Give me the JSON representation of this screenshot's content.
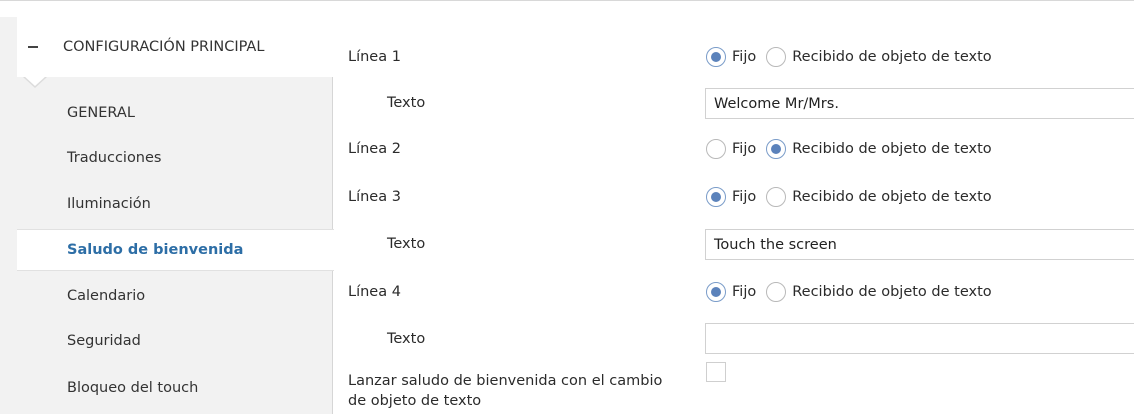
{
  "sidebar": {
    "header_label": "CONFIGURACIÓN PRINCIPAL",
    "items": [
      {
        "label": "GENERAL"
      },
      {
        "label": "Traducciones"
      },
      {
        "label": "Iluminación"
      },
      {
        "label": "Saludo de bienvenida",
        "active": true
      },
      {
        "label": "Calendario"
      },
      {
        "label": "Seguridad"
      },
      {
        "label": "Bloqueo del touch"
      }
    ]
  },
  "main": {
    "option_fixed": "Fijo",
    "option_received": "Recibido de objeto de texto",
    "lines": [
      {
        "label": "Línea 1",
        "selected": "Fijo",
        "text_label": "Texto",
        "text_value": "Welcome Mr/Mrs."
      },
      {
        "label": "Línea 2",
        "selected": "Recibido de objeto de texto"
      },
      {
        "label": "Línea 3",
        "selected": "Fijo",
        "text_label": "Texto",
        "text_value": "Touch the screen"
      },
      {
        "label": "Línea 4",
        "selected": "Fijo",
        "text_label": "Texto",
        "text_value": ""
      }
    ],
    "launch_label_line1": "Lanzar saludo de bienvenida con el cambio",
    "launch_label_line2": "de objeto de texto",
    "launch_checked": false
  },
  "colors": {
    "accent": "#2d6ea6",
    "radio_fill": "#5b82bb",
    "sidebar_bg": "#f2f2f2"
  }
}
